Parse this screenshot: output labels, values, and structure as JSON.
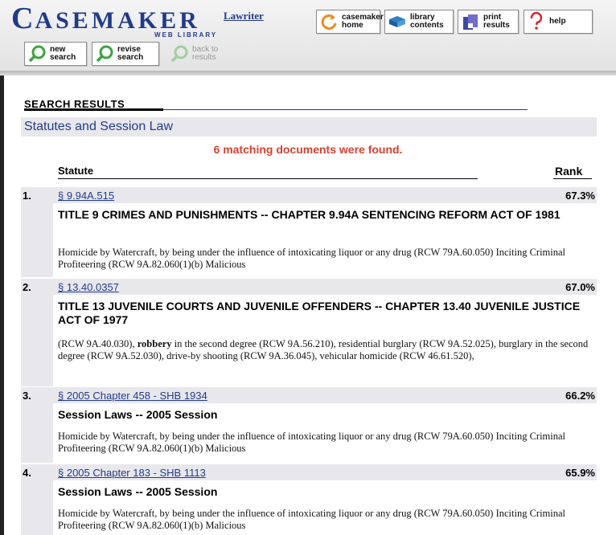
{
  "header": {
    "logo_text": "CASEMAKER",
    "logo_subtitle": "WEB LIBRARY",
    "lawriter_link": "Lawriter",
    "buttons": {
      "home": "casemaker\nhome",
      "library": "library\ncontents",
      "print": "print\nresults",
      "help": "help",
      "new_search": "new\nsearch",
      "revise_search": "revise\nsearch",
      "back": "back to\nresults"
    }
  },
  "main": {
    "section_heading": "SEARCH RESULTS",
    "category_title": "Statutes and Session Law",
    "match_count": "6 matching documents were found.",
    "columns": {
      "statute": "Statute",
      "rank": "Rank"
    },
    "results": [
      {
        "number": "1.",
        "link": "§ 9.94A.515",
        "rank": "67.3%",
        "title": "TITLE 9 CRIMES AND PUNISHMENTS -- CHAPTER 9.94A SENTENCING REFORM ACT OF 1981",
        "snippet_parts": [
          "  Homicide by Watercraft, by being under the influence of intoxicating liquor or any drug (RCW 79A.60.050)      Inciting Criminal Profiteering (RCW 9A.82.060(1)(b)      Malicious"
        ]
      },
      {
        "number": "2.",
        "link": "§ 13.40.0357",
        "rank": "67.0%",
        "title": "TITLE 13 JUVENILE COURTS AND JUVENILE OFFENDERS -- CHAPTER 13.40 JUVENILE JUSTICE ACT OF 1977",
        "snippet_before": "(RCW 9A.40.030), ",
        "snippet_bold": "robbery",
        "snippet_after": " in the second degree (RCW 9A.56.210), residential burglary (RCW 9A.52.025), burglary in the second degree (RCW 9A.52.030), drive-by shooting (RCW 9A.36.045), vehicular homicide (RCW 46.61.520),"
      },
      {
        "number": "3.",
        "link": "§ 2005 Chapter 458 - SHB 1934",
        "rank": "66.2%",
        "title": "Session Laws -- 2005 Session",
        "snippet": "  Homicide by Watercraft, by being under the influence of intoxicating liquor or any drug (RCW 79A.60.050)      Inciting Criminal Profiteering (RCW 9A.82.060(1)(b)      Malicious"
      },
      {
        "number": "4.",
        "link": "§ 2005 Chapter 183 - SHB 1113",
        "rank": "65.9%",
        "title": "Session Laws -- 2005 Session",
        "snippet": "  Homicide by Watercraft, by being under the influence of intoxicating liquor or any drug (RCW 79A.60.050)      Inciting Criminal Profiteering (RCW 9A.82.060(1)(b)      Malicious"
      }
    ]
  },
  "colors": {
    "brand_blue": "#1f3b8c",
    "match_red": "#d8412e",
    "row_shade": "#e8e8ec",
    "icon_green": "#3aa63a",
    "icon_orange": "#f08a1c",
    "icon_red": "#d8232a"
  },
  "icons": [
    "home-refresh-icon",
    "library-book-icon",
    "print-icon",
    "help-question-icon",
    "magnifier-icon"
  ]
}
